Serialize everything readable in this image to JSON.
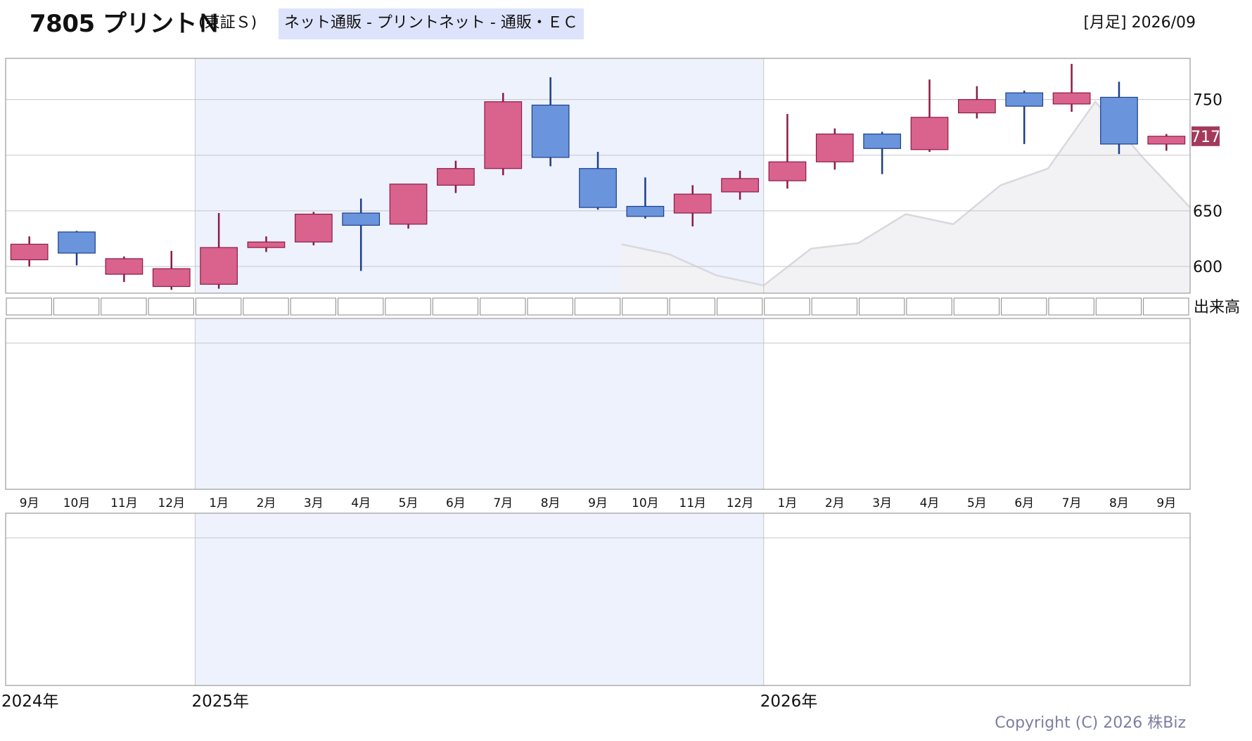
{
  "header": {
    "title": "7805 プリントＮ",
    "market": "(東証Ｓ)",
    "sector": "ネット通販 - プリントネット - 通販・ＥＣ",
    "period": "[月足] 2026/09"
  },
  "footer": {
    "copyright": "Copyright (C) 2026 株Biz"
  },
  "chart_data": {
    "type": "candlestick",
    "categories": [
      "9月",
      "10月",
      "11月",
      "12月",
      "1月",
      "2月",
      "3月",
      "4月",
      "5月",
      "6月",
      "7月",
      "8月",
      "9月",
      "10月",
      "11月",
      "12月",
      "1月",
      "2月",
      "3月",
      "4月",
      "5月",
      "6月",
      "7月",
      "8月",
      "9月"
    ],
    "ohlc": [
      {
        "open": 606,
        "high": 627,
        "low": 600,
        "close": 620
      },
      {
        "open": 631,
        "high": 632,
        "low": 601,
        "close": 612
      },
      {
        "open": 593,
        "high": 609,
        "low": 586,
        "close": 607
      },
      {
        "open": 582,
        "high": 614,
        "low": 579,
        "close": 598
      },
      {
        "open": 584,
        "high": 648,
        "low": 580,
        "close": 617
      },
      {
        "open": 617,
        "high": 627,
        "low": 613,
        "close": 622
      },
      {
        "open": 622,
        "high": 649,
        "low": 619,
        "close": 647
      },
      {
        "open": 648,
        "high": 661,
        "low": 596,
        "close": 637
      },
      {
        "open": 638,
        "high": 672,
        "low": 634,
        "close": 674
      },
      {
        "open": 673,
        "high": 695,
        "low": 666,
        "close": 688
      },
      {
        "open": 688,
        "high": 756,
        "low": 682,
        "close": 748
      },
      {
        "open": 745,
        "high": 770,
        "low": 690,
        "close": 698
      },
      {
        "open": 688,
        "high": 703,
        "low": 651,
        "close": 653
      },
      {
        "open": 654,
        "high": 680,
        "low": 643,
        "close": 645
      },
      {
        "open": 648,
        "high": 673,
        "low": 636,
        "close": 665
      },
      {
        "open": 667,
        "high": 686,
        "low": 660,
        "close": 679
      },
      {
        "open": 677,
        "high": 737,
        "low": 670,
        "close": 694
      },
      {
        "open": 694,
        "high": 724,
        "low": 687,
        "close": 719
      },
      {
        "open": 719,
        "high": 721,
        "low": 683,
        "close": 706
      },
      {
        "open": 705,
        "high": 768,
        "low": 703,
        "close": 734
      },
      {
        "open": 738,
        "high": 762,
        "low": 733,
        "close": 750
      },
      {
        "open": 756,
        "high": 758,
        "low": 710,
        "close": 744
      },
      {
        "open": 746,
        "high": 782,
        "low": 739,
        "close": 756
      },
      {
        "open": 752,
        "high": 766,
        "low": 701,
        "close": 710
      },
      {
        "open": 710,
        "high": 719,
        "low": 704,
        "close": 717
      }
    ],
    "y_ticks": [
      600,
      650,
      750
    ],
    "ylim": [
      576,
      787
    ],
    "last_price": "717",
    "background_trend": [
      {
        "index": 12.5,
        "value": 620
      },
      {
        "index": 13.5,
        "value": 611
      },
      {
        "index": 14.5,
        "value": 592
      },
      {
        "index": 15.5,
        "value": 583
      },
      {
        "index": 16.5,
        "value": 616
      },
      {
        "index": 17.5,
        "value": 621
      },
      {
        "index": 18.5,
        "value": 647
      },
      {
        "index": 19.5,
        "value": 638
      },
      {
        "index": 20.5,
        "value": 673
      },
      {
        "index": 21.5,
        "value": 688
      },
      {
        "index": 22.5,
        "value": 748
      },
      {
        "index": 23.5,
        "value": 698
      },
      {
        "index": 24.5,
        "value": 653
      }
    ],
    "volume_label": "出来高",
    "year_labels": [
      {
        "index": 0,
        "label": "2024年"
      },
      {
        "index": 4,
        "label": "2025年"
      },
      {
        "index": 16,
        "label": "2026年"
      }
    ],
    "shaded_range": [
      4,
      16
    ],
    "colors": {
      "up_fill": "#d9638c",
      "up_edge": "#8c1a45",
      "down_fill": "#6a94dc",
      "down_edge": "#1c3f8c",
      "shade": "#edf2fd",
      "trend": "#d8d8de",
      "trend_fill": "#f2f2f5",
      "last_price_bg": "#a33a5c",
      "grid": "#c6c6c6",
      "border": "#9b9b9b"
    }
  }
}
